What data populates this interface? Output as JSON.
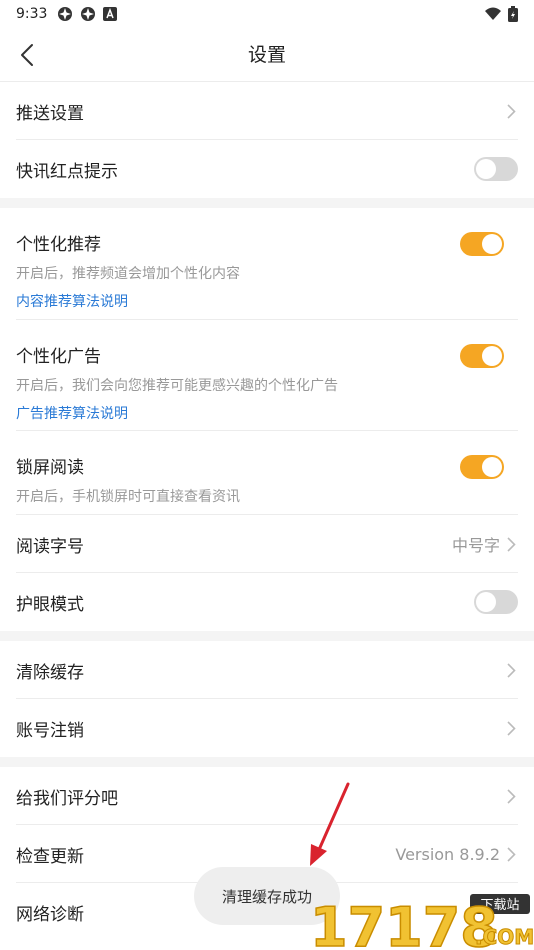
{
  "status_bar": {
    "time": "9:33"
  },
  "nav": {
    "title": "设置"
  },
  "settings": {
    "push": {
      "label": "推送设置"
    },
    "flash_dot": {
      "label": "快讯红点提示",
      "enabled": false
    },
    "personal_recommend": {
      "label": "个性化推荐",
      "desc": "开启后，推荐频道会增加个性化内容",
      "link": "内容推荐算法说明",
      "enabled": true
    },
    "personal_ads": {
      "label": "个性化广告",
      "desc": "开启后，我们会向您推荐可能更感兴趣的个性化广告",
      "link": "广告推荐算法说明",
      "enabled": true
    },
    "lock_read": {
      "label": "锁屏阅读",
      "desc": "开启后，手机锁屏时可直接查看资讯",
      "enabled": true
    },
    "font_size": {
      "label": "阅读字号",
      "value": "中号字"
    },
    "eye_mode": {
      "label": "护眼模式",
      "enabled": false
    },
    "clear_cache": {
      "label": "清除缓存"
    },
    "account_cancel": {
      "label": "账号注销"
    },
    "rate": {
      "label": "给我们评分吧"
    },
    "update": {
      "label": "检查更新",
      "value": "Version 8.9.2"
    },
    "network": {
      "label": "网络诊断"
    }
  },
  "toast": {
    "text": "清理缓存成功"
  },
  "watermark": {
    "top": "下载站",
    "main": "17178",
    "sub": ".COM"
  },
  "colors": {
    "accent": "#f5a623",
    "link": "#2a7ad6",
    "divider": "#ececec",
    "section_gap": "#f4f4f4",
    "arrow": "#d9232e"
  }
}
